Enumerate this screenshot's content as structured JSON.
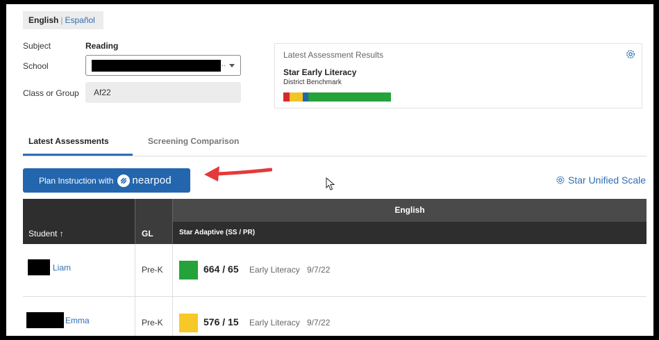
{
  "language": {
    "active": "English",
    "other": "Español"
  },
  "filters": {
    "subject_label": "Subject",
    "subject_value": "Reading",
    "school_label": "School",
    "school_ellipsis": "..",
    "class_label": "Class or Group",
    "class_value": "Af22"
  },
  "latest_results": {
    "title": "Latest Assessment Results",
    "assessment_name": "Star Early Literacy",
    "benchmark": "District Benchmark",
    "bar_segments": [
      {
        "color": "#d62a2a",
        "fraction": 0.06
      },
      {
        "color": "#f2c427",
        "fraction": 0.12
      },
      {
        "color": "#2366ad",
        "fraction": 0.05
      },
      {
        "color": "#23a33a",
        "fraction": 0.77
      }
    ]
  },
  "tabs": [
    {
      "label": "Latest Assessments",
      "active": true
    },
    {
      "label": "Screening Comparison",
      "active": false
    }
  ],
  "toolbar": {
    "plan_button_label": "Plan Instruction with",
    "nearpod_logo_text": "nearpod",
    "scale_link_label": "Star Unified Scale"
  },
  "table": {
    "col_student": "Student",
    "col_gl": "GL",
    "group_header": "English",
    "col_star": "Star Adaptive (SS / PR)",
    "rows": [
      {
        "name": "Liam",
        "gl": "Pre-K",
        "score": "664 / 65",
        "test": "Early Literacy",
        "date": "9/7/22",
        "color": "#23a33a"
      },
      {
        "name": "Emma",
        "gl": "Pre-K",
        "score": "576 / 15",
        "test": "Early Literacy",
        "date": "9/7/22",
        "color": "#f7c928"
      }
    ]
  },
  "colors": {
    "accent": "#2366ad",
    "link": "#2f6db3",
    "annotation_arrow": "#e5393a"
  }
}
